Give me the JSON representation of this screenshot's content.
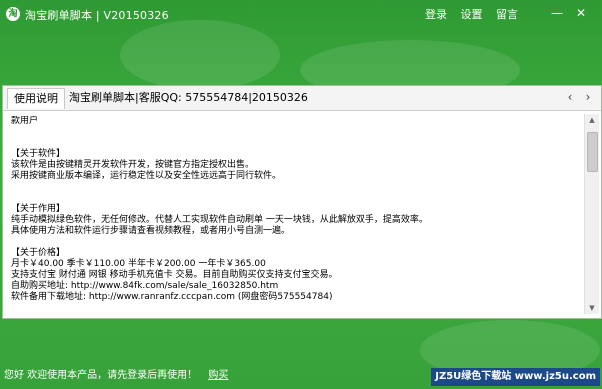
{
  "window": {
    "title": "淘宝刷单脚本 | V20150326",
    "icon": "app-icon",
    "links": [
      "登录",
      "设置",
      "留言"
    ],
    "buttons": {
      "minimize": "—",
      "close": "✕"
    }
  },
  "tabs": {
    "active": "使用说明",
    "info": "淘宝刷单脚本|客服QQ: 575554784|20150326",
    "prev": "‹",
    "next": "›"
  },
  "content": {
    "lines": [
      "款用户",
      "",
      "",
      "【关于软件】",
      "该软件是由按键精灵开发软件开发，按键官方指定授权出售。",
      "采用按键商业版本编译，运行稳定性以及安全性远远高于同行软件。",
      "",
      "",
      "【关于作用】",
      "纯手动模拟绿色软件，无任何修改。代替人工实现软件自动刷单 一天一块钱，从此解放双手，提高效率。",
      "具体使用方法和软件运行步骤请查看视频教程，或者用小号自测一遍。",
      "",
      "【关于价格】",
      "月卡￥40.00  季卡￥110.00  半年卡￥200.00  一年卡￥365.00",
      "支持支付宝 财付通 网银 移动手机充值卡 交易。目前自助购买仅支持支付宝交易。",
      "自助购买地址: http://www.84fk.com/sale/sale_16032850.htm",
      "软件备用下载地址: http://www.ranranfz.cccpan.com   (网盘密码575554784)"
    ]
  },
  "status": {
    "message": "您好 欢迎使用本产品，请先登录后再使用！",
    "buy_link": "购买"
  },
  "watermark": "JZ5U绿色下载站 www.jz5u.com"
}
